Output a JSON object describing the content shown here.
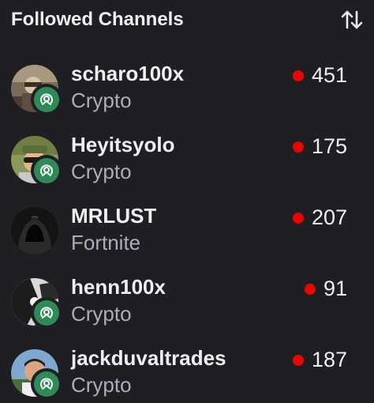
{
  "header": {
    "title": "Followed Channels",
    "sort_icon": "sort-arrows-icon"
  },
  "colors": {
    "background": "#1f1f23",
    "live_dot": "#eb0400",
    "badge": "#2e8b57",
    "secondary_text": "#adadb8"
  },
  "channels": [
    {
      "name": "scharo100x",
      "category": "Crypto",
      "viewers": "451",
      "badge": true
    },
    {
      "name": "Heyitsyolo",
      "category": "Crypto",
      "viewers": "175",
      "badge": true
    },
    {
      "name": "MRLUST",
      "category": "Fortnite",
      "viewers": "207",
      "badge": false
    },
    {
      "name": "henn100x",
      "category": "Crypto",
      "viewers": "91",
      "badge": true
    },
    {
      "name": "jackduvaltrades",
      "category": "Crypto",
      "viewers": "187",
      "badge": true
    }
  ]
}
